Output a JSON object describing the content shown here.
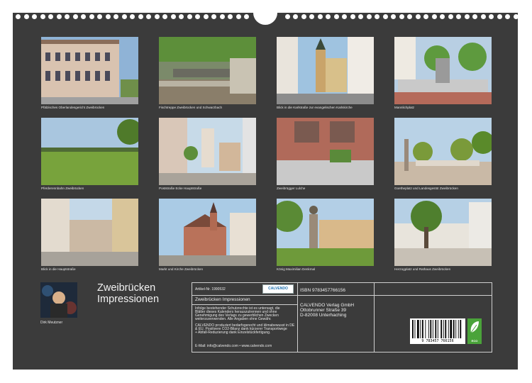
{
  "photos": [
    {
      "caption": "Pfälzisches Oberlandesgericht Zweibrücken"
    },
    {
      "caption": "Fischtreppe Zweibrücken und Schwarzbach"
    },
    {
      "caption": "Blick in die Karlstraße zur evangelischen Karlskirche"
    },
    {
      "caption": "Mannlichplatz"
    },
    {
      "caption": "Pferderennbahn Zweibrücken"
    },
    {
      "caption": "Poststraße Ecke Hauptstraße"
    },
    {
      "caption": "Zweibrügger Lulche"
    },
    {
      "caption": "Goetheplatz und Landesgestüt Zweibrücken"
    },
    {
      "caption": "Blick in die Hauptstraße"
    },
    {
      "caption": "Markt und Kirche Zweibrücken"
    },
    {
      "caption": "König Maximilian Denkmal"
    },
    {
      "caption": "Herzogplatz und Rathaus Zweibrücken"
    }
  ],
  "calendar": {
    "title_line1": "Zweibrücken",
    "title_line2": "Impressionen",
    "author": "Dirk Meutzner"
  },
  "info": {
    "article_no": "Artikel-Nr. 1990532",
    "logo": "CALVENDO",
    "product_title": "Zweibrücken Impressionen",
    "legal_text_1": "Infolge bestehender Schutzrechte ist es untersagt, die",
    "legal_text_2": "Blätter dieses Kalenders herauszutrennen und ohne",
    "legal_text_3": "Genehmigung des Verlags zu gewerblichen Zwecken",
    "legal_text_4": "weiterzuverwenden. Alle Angaben ohne Gewähr.",
    "eco_text_1": "CALVENDO produziert bedarfsgerecht und klimabewusst in DE",
    "eco_text_2": "& EU. Positivere CO2-Bilanz dank kürzerer Transportwege",
    "eco_text_3": "+ Abfall-Reduzierung dank Einzelstückfertigung.",
    "email": "E-Mail: info@calvendo.com • www.calvendo.com",
    "isbn": "ISBN 9783457766156",
    "publisher_1": "CALVENDO Verlag GmbH",
    "publisher_2": "Ottobrunner Straße 39",
    "publisher_3": "D-82008 Unterhaching",
    "barcode_number": "9 783457 766156",
    "eco_label": "ECO"
  }
}
